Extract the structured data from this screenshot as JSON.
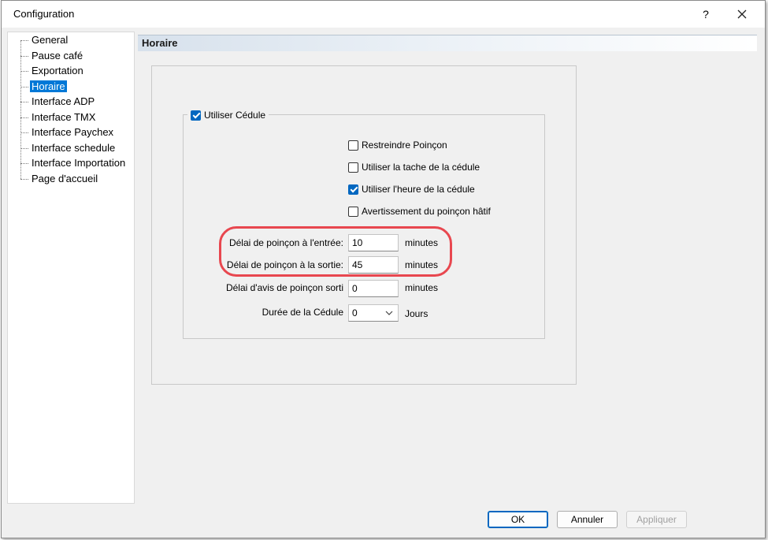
{
  "window": {
    "title": "Configuration",
    "help_label": "?"
  },
  "tree": {
    "selected": "Horaire",
    "items": [
      "General",
      "Pause café",
      "Exportation",
      "Horaire",
      "Interface ADP",
      "Interface TMX",
      "Interface Paychex",
      "Interface schedule",
      "Interface Importation",
      "Page d'accueil"
    ]
  },
  "panel": {
    "title": "Horaire",
    "group_checkbox": {
      "label": "Utiliser Cédule",
      "checked": true
    },
    "checkboxes": [
      {
        "label": "Restreindre Poinçon",
        "checked": false
      },
      {
        "label": "Utiliser la tache de la cédule",
        "checked": false
      },
      {
        "label": "Utiliser l'heure de la cédule",
        "checked": true
      },
      {
        "label": "Avertissement du poinçon hâtif",
        "checked": false
      }
    ],
    "fields": [
      {
        "label": "Délai de poinçon à l'entrée:",
        "value": "10",
        "unit": "minutes"
      },
      {
        "label": "Délai de poinçon à la sortie:",
        "value": "45",
        "unit": "minutes"
      },
      {
        "label": "Délai d'avis de poinçon sorti",
        "value": "0",
        "unit": "minutes"
      }
    ],
    "duration": {
      "label": "Durée de la Cédule",
      "value": "0",
      "unit": "Jours"
    },
    "highlight_color": "#e8474f"
  },
  "buttons": {
    "ok": "OK",
    "cancel": "Annuler",
    "apply": "Appliquer"
  }
}
